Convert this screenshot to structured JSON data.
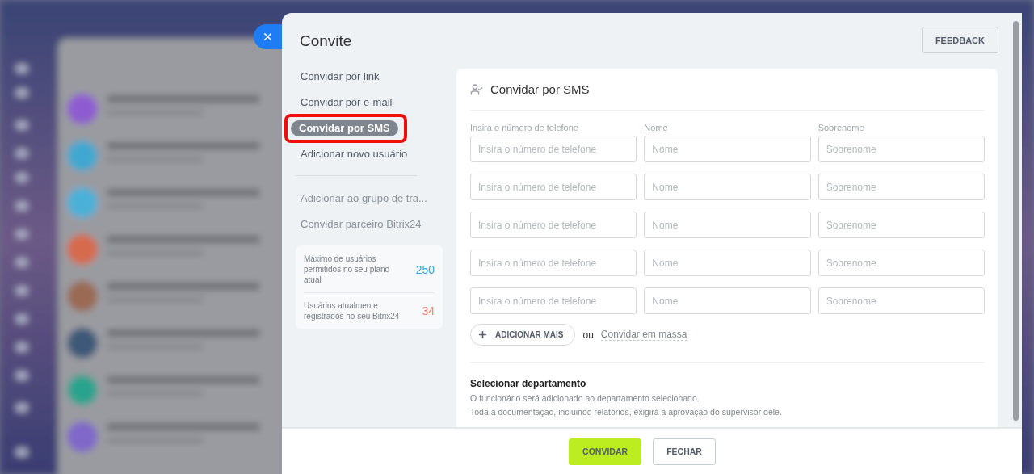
{
  "window": {
    "title": "Convite"
  },
  "feedback_button": {
    "label": "FEEDBACK"
  },
  "sidebar": {
    "primary_items": [
      {
        "label": "Convidar por link",
        "selected": false,
        "disabled": false,
        "highlighted": false
      },
      {
        "label": "Convidar por e-mail",
        "selected": false,
        "disabled": false,
        "highlighted": false
      },
      {
        "label": "Convidar por SMS",
        "selected": true,
        "disabled": false,
        "highlighted": true
      },
      {
        "label": "Adicionar novo usuário",
        "selected": false,
        "disabled": false,
        "highlighted": false
      }
    ],
    "secondary_items": [
      {
        "label": "Adicionar ao grupo de tra...",
        "selected": false,
        "disabled": true,
        "highlighted": false
      },
      {
        "label": "Convidar parceiro Bitrix24",
        "selected": false,
        "disabled": true,
        "highlighted": false
      }
    ],
    "limits": [
      {
        "label": "Máximo de usuários permitidos no seu plano atual",
        "value": "250",
        "color": "#2fa6d9"
      },
      {
        "label": "Usuários atualmente registrados no seu Bitrix24",
        "value": "34",
        "color": "#f0766a"
      }
    ]
  },
  "form": {
    "title": "Convidar por SMS",
    "columns": [
      "Insira o número de telefone",
      "Nome",
      "Sobrenome"
    ],
    "rows": [
      {
        "placeholders": [
          "Insira o número de telefone",
          "Nome",
          "Sobrenome"
        ]
      },
      {
        "placeholders": [
          "Insira o número de telefone",
          "Nome",
          "Sobrenome"
        ]
      },
      {
        "placeholders": [
          "Insira o número de telefone",
          "Nome",
          "Sobrenome"
        ]
      },
      {
        "placeholders": [
          "Insira o número de telefone",
          "Nome",
          "Sobrenome"
        ]
      },
      {
        "placeholders": [
          "Insira o número de telefone",
          "Nome",
          "Sobrenome"
        ]
      }
    ],
    "add_more_button": {
      "label": "ADICIONAR MAIS"
    },
    "or_text": "ou",
    "mass_invite_link": "Convidar em massa",
    "department": {
      "title": "Selecionar departamento",
      "lines": [
        "O funcionário será adicionado ao departamento selecionado.",
        "Toda a documentação, incluindo relatórios, exigirá a aprovação do supervisor dele."
      ]
    }
  },
  "footer": {
    "buttons": [
      {
        "label": "CONVIDAR",
        "kind": "primary"
      },
      {
        "label": "FECHAR",
        "kind": "secondary"
      }
    ]
  }
}
